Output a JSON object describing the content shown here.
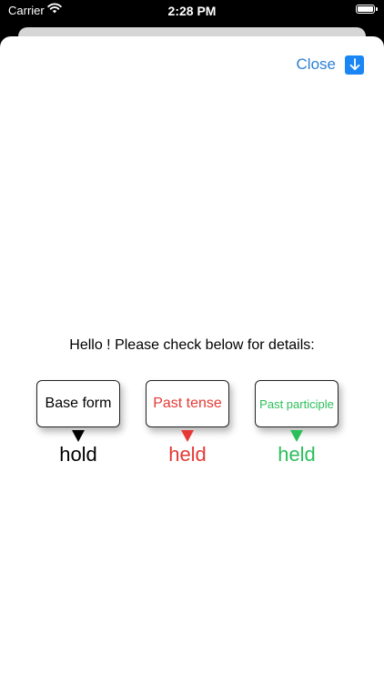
{
  "status_bar": {
    "carrier": "Carrier",
    "time": "2:28 PM"
  },
  "header": {
    "close_label": "Close"
  },
  "main": {
    "greeting": "Hello ! Please check below for details:",
    "forms": [
      {
        "label": "Base form",
        "value": "hold",
        "color": "#000000"
      },
      {
        "label": "Past tense",
        "value": "held",
        "color": "#e53935"
      },
      {
        "label": "Past participle",
        "value": "held",
        "color": "#2bbf5a"
      }
    ]
  },
  "colors": {
    "link": "#2e7fd6",
    "close_icon_bg": "#1a86f5"
  },
  "icons": {
    "wifi": "wifi-icon",
    "battery": "battery-icon",
    "close": "arrow-down-icon"
  }
}
